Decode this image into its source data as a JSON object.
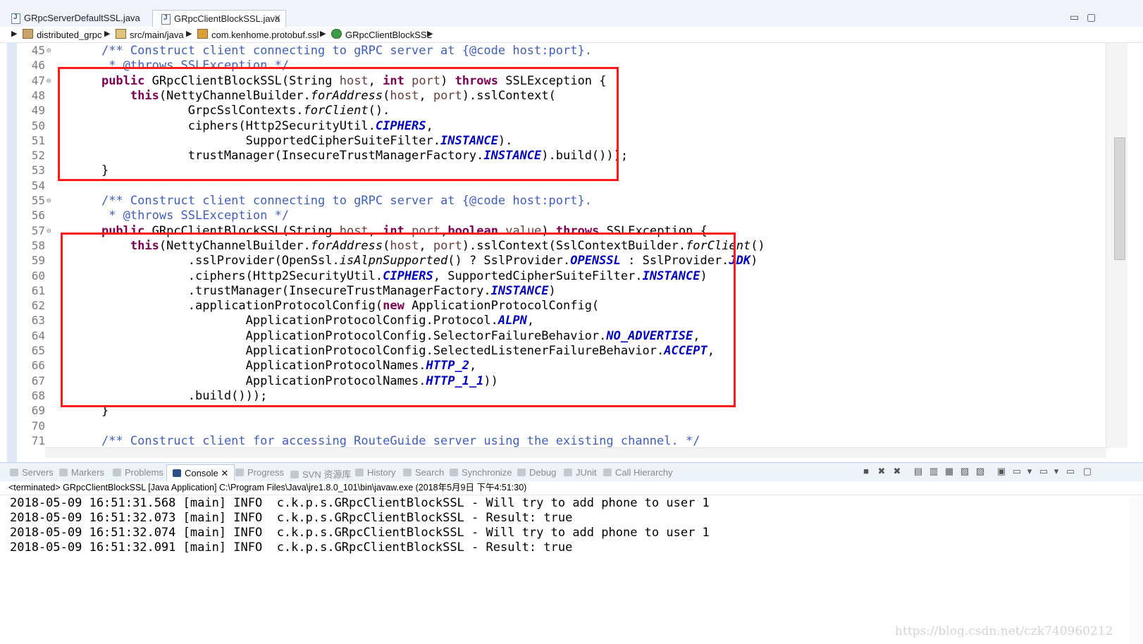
{
  "editor_tabs": [
    {
      "label": "GRpcServerDefaultSSL.java",
      "active": false
    },
    {
      "label": "GRpcClientBlockSSL.java",
      "active": true,
      "close": "✕"
    }
  ],
  "window_controls": {
    "minimize": "▭",
    "maximize": "▢"
  },
  "breadcrumb": [
    "distributed_grpc",
    "src/main/java",
    "com.kenhome.protobuf.ssl",
    "GRpcClientBlockSSL"
  ],
  "code_lines": [
    {
      "n": "45",
      "fold": "⊖",
      "segs": [
        [
          "    ",
          ""
        ],
        [
          "/** Construct client connecting to gRPC server at {@code host:port}.",
          "cm"
        ]
      ]
    },
    {
      "n": "46",
      "fold": "",
      "segs": [
        [
          "     ",
          ""
        ],
        [
          "* @throws SSLException */",
          "cm"
        ]
      ]
    },
    {
      "n": "47",
      "fold": "⊖",
      "segs": [
        [
          "    ",
          ""
        ],
        [
          "public",
          "kw"
        ],
        [
          " GRpcClientBlockSSL(String ",
          ""
        ],
        [
          "host",
          "par"
        ],
        [
          ", ",
          ""
        ],
        [
          "int",
          "kw"
        ],
        [
          " ",
          ""
        ],
        [
          "port",
          "par"
        ],
        [
          ") ",
          ""
        ],
        [
          "throws",
          "kw"
        ],
        [
          " SSLException {",
          ""
        ]
      ]
    },
    {
      "n": "48",
      "fold": "",
      "segs": [
        [
          "        ",
          ""
        ],
        [
          "this",
          "kw"
        ],
        [
          "(NettyChannelBuilder.",
          ""
        ],
        [
          "forAddress",
          "it"
        ],
        [
          "(",
          ""
        ],
        [
          "host",
          "par"
        ],
        [
          ", ",
          ""
        ],
        [
          "port",
          "par"
        ],
        [
          ").sslContext(",
          ""
        ]
      ]
    },
    {
      "n": "49",
      "fold": "",
      "segs": [
        [
          "                GrpcSslContexts.",
          ""
        ],
        [
          "forClient",
          "it"
        ],
        [
          "().",
          ""
        ]
      ]
    },
    {
      "n": "50",
      "fold": "",
      "segs": [
        [
          "                ciphers(Http2SecurityUtil.",
          ""
        ],
        [
          "CIPHERS",
          "fld"
        ],
        [
          ",",
          ""
        ]
      ]
    },
    {
      "n": "51",
      "fold": "",
      "segs": [
        [
          "                        SupportedCipherSuiteFilter.",
          ""
        ],
        [
          "INSTANCE",
          "fld"
        ],
        [
          ").",
          ""
        ]
      ]
    },
    {
      "n": "52",
      "fold": "",
      "segs": [
        [
          "                trustManager(InsecureTrustManagerFactory.",
          ""
        ],
        [
          "INSTANCE",
          "fld"
        ],
        [
          ").build()));",
          ""
        ]
      ]
    },
    {
      "n": "53",
      "fold": "",
      "segs": [
        [
          "    }",
          ""
        ]
      ]
    },
    {
      "n": "54",
      "fold": "",
      "segs": [
        [
          "",
          ""
        ]
      ]
    },
    {
      "n": "55",
      "fold": "⊖",
      "segs": [
        [
          "    ",
          ""
        ],
        [
          "/** Construct client connecting to gRPC server at {@code host:port}.",
          "cm"
        ]
      ]
    },
    {
      "n": "56",
      "fold": "",
      "segs": [
        [
          "     ",
          ""
        ],
        [
          "* @throws SSLException */",
          "cm"
        ]
      ]
    },
    {
      "n": "57",
      "fold": "⊖",
      "segs": [
        [
          "    ",
          ""
        ],
        [
          "public",
          "kw"
        ],
        [
          " GRpcClientBlockSSL(String ",
          ""
        ],
        [
          "host",
          "par"
        ],
        [
          ", ",
          ""
        ],
        [
          "int",
          "kw"
        ],
        [
          " ",
          ""
        ],
        [
          "port",
          "par"
        ],
        [
          ",",
          ""
        ],
        [
          "boolean",
          "kw"
        ],
        [
          " ",
          ""
        ],
        [
          "value",
          "par"
        ],
        [
          ") ",
          ""
        ],
        [
          "throws",
          "kw"
        ],
        [
          " SSLException {",
          ""
        ]
      ]
    },
    {
      "n": "58",
      "fold": "",
      "segs": [
        [
          "        ",
          ""
        ],
        [
          "this",
          "kw"
        ],
        [
          "(NettyChannelBuilder.",
          ""
        ],
        [
          "forAddress",
          "it"
        ],
        [
          "(",
          ""
        ],
        [
          "host",
          "par"
        ],
        [
          ", ",
          ""
        ],
        [
          "port",
          "par"
        ],
        [
          ").sslContext(SslContextBuilder.",
          ""
        ],
        [
          "forClient",
          "it"
        ],
        [
          "()",
          ""
        ]
      ]
    },
    {
      "n": "59",
      "fold": "",
      "segs": [
        [
          "                .sslProvider(OpenSsl.",
          ""
        ],
        [
          "isAlpnSupported",
          "it"
        ],
        [
          "() ? SslProvider.",
          ""
        ],
        [
          "OPENSSL",
          "fld"
        ],
        [
          " : SslProvider.",
          ""
        ],
        [
          "JDK",
          "fld"
        ],
        [
          ")",
          ""
        ]
      ]
    },
    {
      "n": "60",
      "fold": "",
      "segs": [
        [
          "                .ciphers(Http2SecurityUtil.",
          ""
        ],
        [
          "CIPHERS",
          "fld"
        ],
        [
          ", SupportedCipherSuiteFilter.",
          ""
        ],
        [
          "INSTANCE",
          "fld"
        ],
        [
          ")",
          ""
        ]
      ]
    },
    {
      "n": "61",
      "fold": "",
      "segs": [
        [
          "                .trustManager(InsecureTrustManagerFactory.",
          ""
        ],
        [
          "INSTANCE",
          "fld"
        ],
        [
          ")",
          ""
        ]
      ]
    },
    {
      "n": "62",
      "fold": "",
      "segs": [
        [
          "                .applicationProtocolConfig(",
          ""
        ],
        [
          "new",
          "kw"
        ],
        [
          " ApplicationProtocolConfig(",
          ""
        ]
      ]
    },
    {
      "n": "63",
      "fold": "",
      "segs": [
        [
          "                        ApplicationProtocolConfig.Protocol.",
          ""
        ],
        [
          "ALPN",
          "fld"
        ],
        [
          ",",
          ""
        ]
      ]
    },
    {
      "n": "64",
      "fold": "",
      "segs": [
        [
          "                        ApplicationProtocolConfig.SelectorFailureBehavior.",
          ""
        ],
        [
          "NO_ADVERTISE",
          "fld"
        ],
        [
          ",",
          ""
        ]
      ]
    },
    {
      "n": "65",
      "fold": "",
      "segs": [
        [
          "                        ApplicationProtocolConfig.SelectedListenerFailureBehavior.",
          ""
        ],
        [
          "ACCEPT",
          "fld"
        ],
        [
          ",",
          ""
        ]
      ]
    },
    {
      "n": "66",
      "fold": "",
      "segs": [
        [
          "                        ApplicationProtocolNames.",
          ""
        ],
        [
          "HTTP_2",
          "fld"
        ],
        [
          ",",
          ""
        ]
      ]
    },
    {
      "n": "67",
      "fold": "",
      "segs": [
        [
          "                        ApplicationProtocolNames.",
          ""
        ],
        [
          "HTTP_1_1",
          "fld"
        ],
        [
          "))",
          ""
        ]
      ]
    },
    {
      "n": "68",
      "fold": "",
      "segs": [
        [
          "                .build()));",
          ""
        ]
      ]
    },
    {
      "n": "69",
      "fold": "",
      "segs": [
        [
          "    }",
          ""
        ]
      ]
    },
    {
      "n": "70",
      "fold": "",
      "segs": [
        [
          "",
          ""
        ]
      ]
    },
    {
      "n": "71",
      "fold": "",
      "segs": [
        [
          "    ",
          ""
        ],
        [
          "/** Construct client for accessing RouteGuide server using the existing channel. */",
          "cm"
        ]
      ]
    }
  ],
  "view_tabs": [
    {
      "label": "Servers",
      "active": false
    },
    {
      "label": "Markers",
      "active": false
    },
    {
      "label": "Problems",
      "active": false
    },
    {
      "label": "Console",
      "active": true
    },
    {
      "label": "Progress",
      "active": false
    },
    {
      "label": "SVN 资源库",
      "active": false
    },
    {
      "label": "History",
      "active": false
    },
    {
      "label": "Search",
      "active": false
    },
    {
      "label": "Synchronize",
      "active": false
    },
    {
      "label": "Debug",
      "active": false
    },
    {
      "label": "JUnit",
      "active": false
    },
    {
      "label": "Call Hierarchy",
      "active": false
    }
  ],
  "console": {
    "status": "<terminated> GRpcClientBlockSSL [Java Application] C:\\Program Files\\Java\\jre1.8.0_101\\bin\\javaw.exe (2018年5月9日 下午4:51:30)",
    "lines": [
      "2018-05-09 16:51:31.568 [main] INFO  c.k.p.s.GRpcClientBlockSSL - Will try to add phone to user 1",
      "2018-05-09 16:51:32.073 [main] INFO  c.k.p.s.GRpcClientBlockSSL - Result: true",
      "2018-05-09 16:51:32.074 [main] INFO  c.k.p.s.GRpcClientBlockSSL - Will try to add phone to user 1",
      "2018-05-09 16:51:32.091 [main] INFO  c.k.p.s.GRpcClientBlockSSL - Result: true"
    ]
  },
  "watermark": "https://blog.csdn.net/czk740960212",
  "colors": {
    "highlight_box": "#ff1a1a",
    "comment": "#3f5fbf",
    "keyword": "#7f0055",
    "field": "#0000c0"
  }
}
